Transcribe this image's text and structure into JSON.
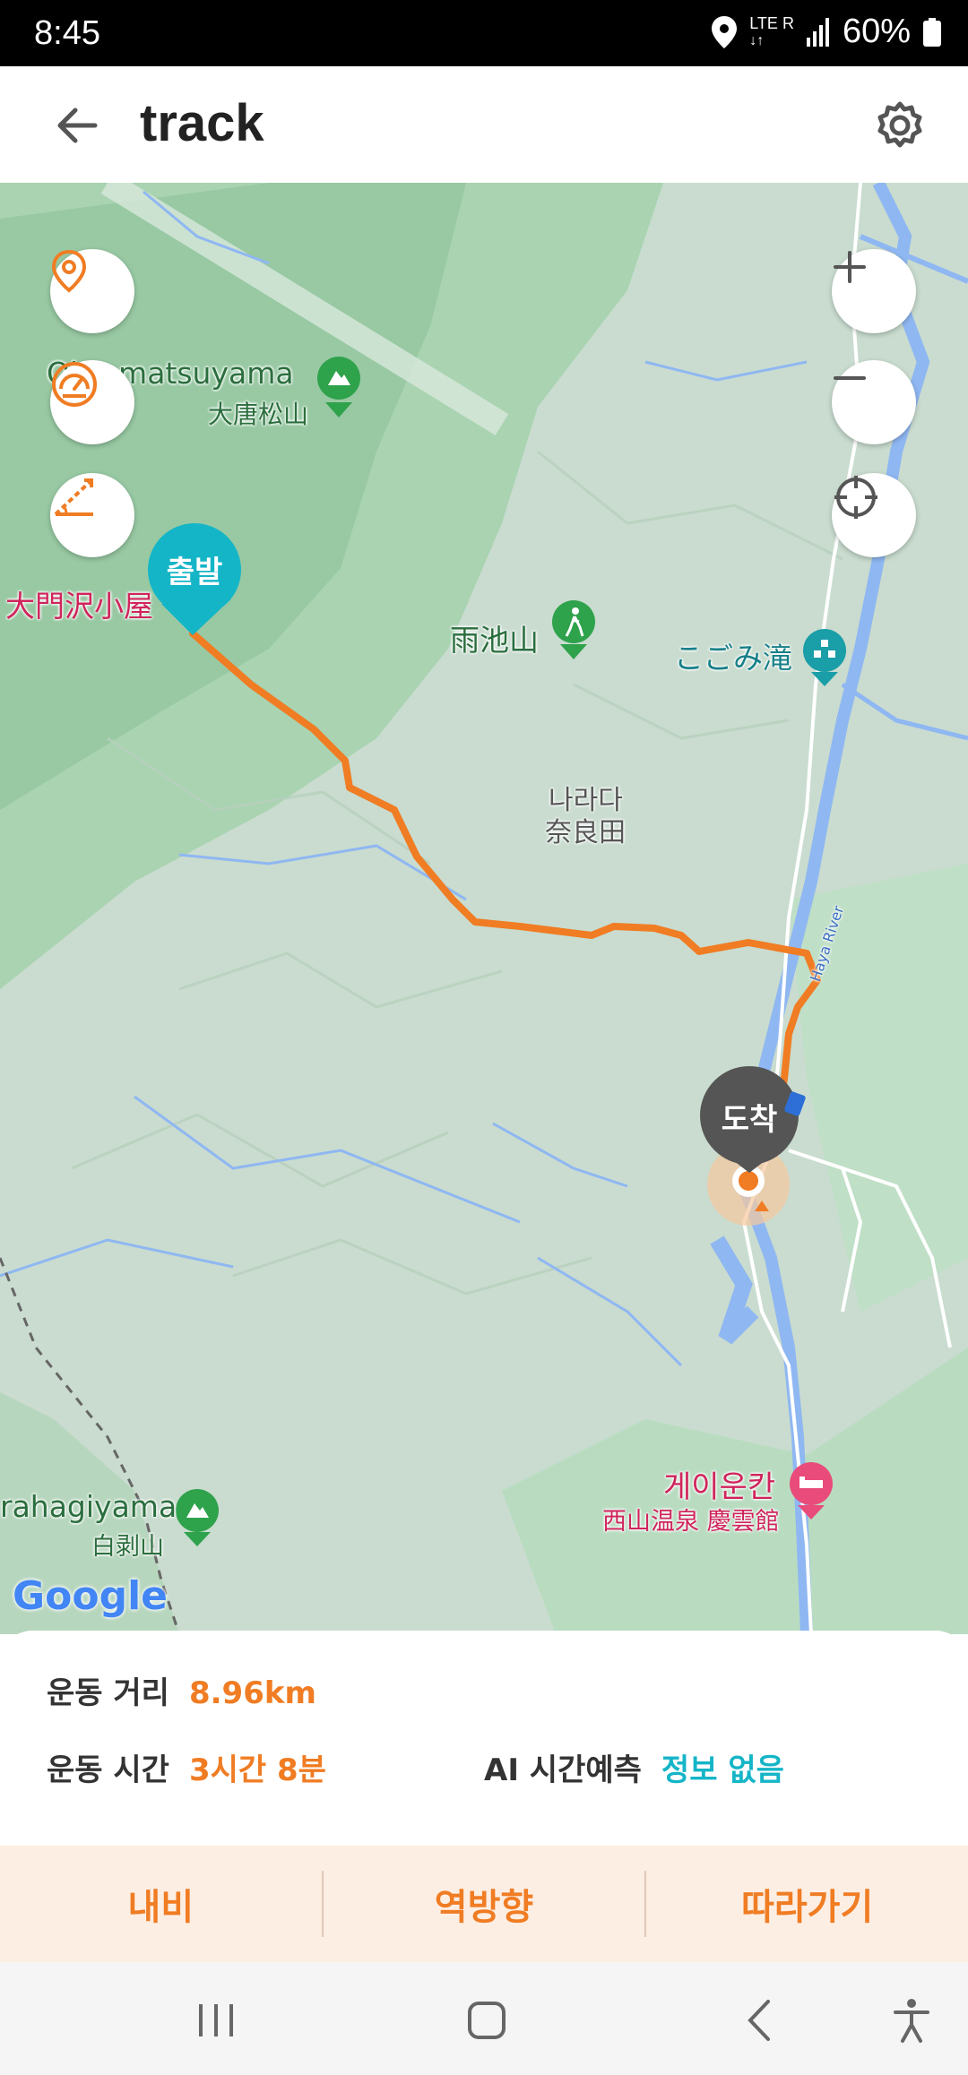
{
  "status": {
    "time": "8:45",
    "network_top": "LTE",
    "network_r": "R",
    "battery": "60%"
  },
  "app_bar": {
    "title": "track",
    "back_icon": "arrow-left-icon",
    "settings_icon": "gear-icon"
  },
  "map": {
    "labels": {
      "mountain1_en": "Ohtamatsuyama",
      "mountain1_jp": "大唐松山",
      "hut": "大門沢小屋",
      "amaike": "雨池山",
      "kogomi": "こごみ滝",
      "narada_ko": "나라다",
      "narada_jp": "奈良田",
      "river": "Haya River",
      "hotel_ko": "게이운칸",
      "hotel_jp": "西山温泉 慶雲館",
      "mountain2_en": "rahagiyama",
      "mountain2_jp": "白剥山",
      "google": "Google"
    },
    "start_pin": "출발",
    "end_pin": "도착",
    "colors": {
      "route": "#f07c23",
      "start_pin": "#14b5c7",
      "end_pin": "#555555",
      "water": "#8fb7f2"
    }
  },
  "stats": {
    "distance_label": "운동 거리",
    "distance_value": "8.96km",
    "time_label": "운동 시간",
    "time_value": "3시간 8분",
    "ai_label": "AI 시간예측",
    "ai_value": "정보 없음"
  },
  "actions": {
    "navi": "내비",
    "reverse": "역방향",
    "follow": "따라가기"
  }
}
